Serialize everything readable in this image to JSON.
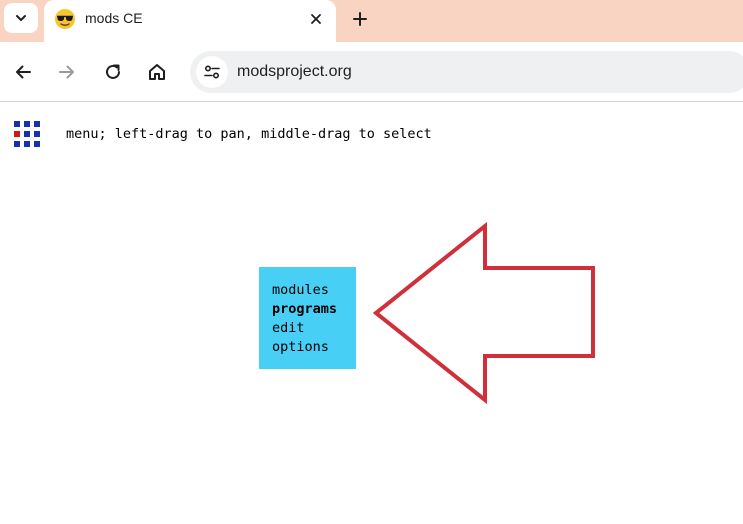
{
  "browser": {
    "tab": {
      "title": "mods CE",
      "favicon": "sunglasses-emoji-icon"
    },
    "address": {
      "url": "modsproject.org"
    },
    "icons": {
      "tab_list": "chevron-down-icon",
      "close_tab": "close-icon",
      "new_tab": "plus-icon",
      "back": "arrow-left-icon",
      "forward": "arrow-right-icon",
      "reload": "reload-icon",
      "home": "home-icon",
      "site_info": "tune-icon"
    },
    "colors": {
      "tabstrip": "#f9d4c2",
      "omnibox": "#eef0f2"
    }
  },
  "page": {
    "hint": "menu; left-drag to pan, middle-drag to select",
    "menu": {
      "items": [
        {
          "label": "modules",
          "bold": false
        },
        {
          "label": "programs",
          "bold": true
        },
        {
          "label": "edit",
          "bold": false
        },
        {
          "label": "options",
          "bold": false
        }
      ],
      "background": "#48cff5"
    },
    "annotation": {
      "arrow_color": "#d0303a"
    },
    "logo_colors": {
      "blue": "#1a2fb0",
      "red": "#d01818"
    }
  }
}
